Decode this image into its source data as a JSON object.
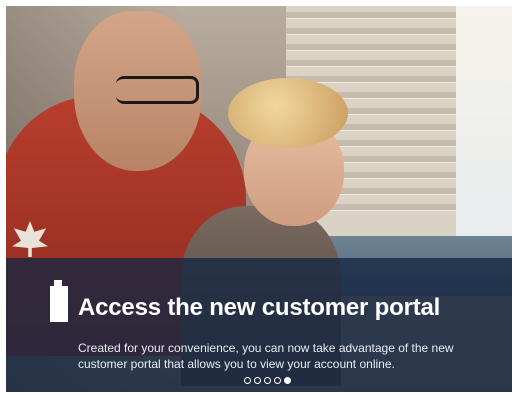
{
  "slide": {
    "headline": "Access the new customer portal",
    "body": "Created for your convenience, you can now take advantage of the new customer portal that allows you to view your account online."
  },
  "pagination": {
    "count": 5,
    "active_index": 4
  },
  "icons": {
    "headline_marker": "phone-icon"
  },
  "colors": {
    "overlay": "#14264299",
    "text": "#ffffff"
  }
}
